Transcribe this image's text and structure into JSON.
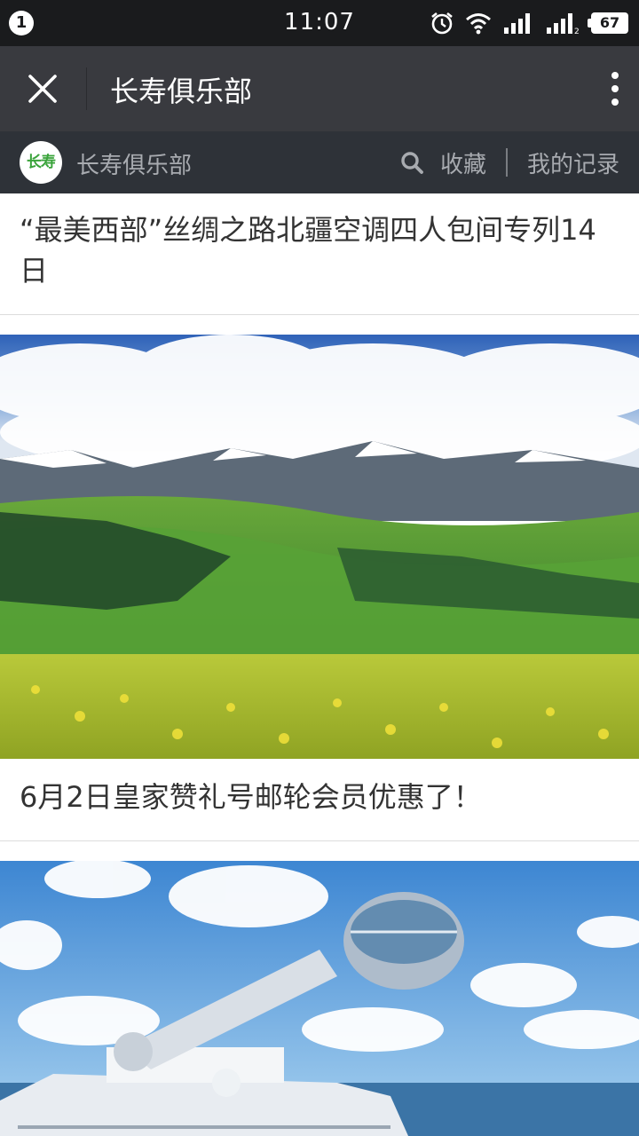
{
  "status_bar": {
    "notification_count": "1",
    "time": "11:07",
    "battery": "67",
    "icons": [
      "alarm-icon",
      "wifi-icon",
      "signal-icon",
      "signal-2-icon",
      "battery-icon"
    ]
  },
  "title_bar": {
    "title": "长寿俱乐部",
    "close_icon": "close-icon",
    "more_icon": "more-vertical-icon"
  },
  "account_bar": {
    "logo_text": "长寿",
    "name": "长寿俱乐部",
    "favorite_label": "收藏",
    "records_label": "我的记录",
    "search_icon": "search-icon"
  },
  "articles": [
    {
      "title": "“最美西部”丝绸之路北疆空调四人包间专列14日",
      "image": "mountain-meadow-landscape"
    },
    {
      "title": "6月2日皇家赞礼号邮轮会员优惠了！",
      "image": "cruise-ship-observation-pod"
    }
  ],
  "colors": {
    "status_bar_bg": "#1a1b1d",
    "title_bar_bg": "#393a3f",
    "account_bar_bg": "#2e3238",
    "logo_green": "#3aa33b"
  }
}
